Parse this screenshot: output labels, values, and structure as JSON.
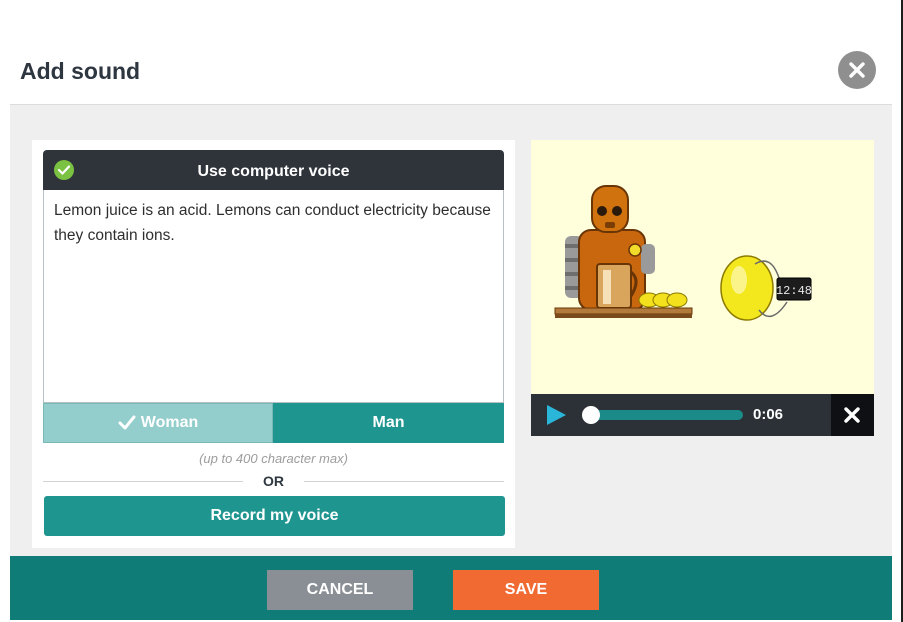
{
  "dialog": {
    "title": "Add sound",
    "close_icon": "close-icon"
  },
  "computer_voice": {
    "header_label": "Use computer voice",
    "selected_icon": "check-circle-icon",
    "text_value": "Lemon juice is an acid. Lemons can conduct electricity because they contain ions.",
    "voices": [
      {
        "label": "Woman",
        "selected": true
      },
      {
        "label": "Man",
        "selected": false
      }
    ],
    "char_limit_note": "(up to 400 character max)"
  },
  "divider": {
    "label": "OR"
  },
  "record": {
    "label": "Record my voice"
  },
  "preview": {
    "clock_display": "12:48"
  },
  "player": {
    "play_icon": "play-icon",
    "time": "0:06",
    "progress": 0.0,
    "remove_icon": "close-icon"
  },
  "footer": {
    "cancel_label": "CANCEL",
    "save_label": "SAVE"
  },
  "colors": {
    "teal": "#1f9590",
    "teal_dark": "#0f7c78",
    "teal_light": "#93cdcc",
    "header_dark": "#2f343b",
    "save_orange": "#f06a32",
    "cancel_gray": "#8a8f95",
    "check_green": "#7cc242"
  }
}
